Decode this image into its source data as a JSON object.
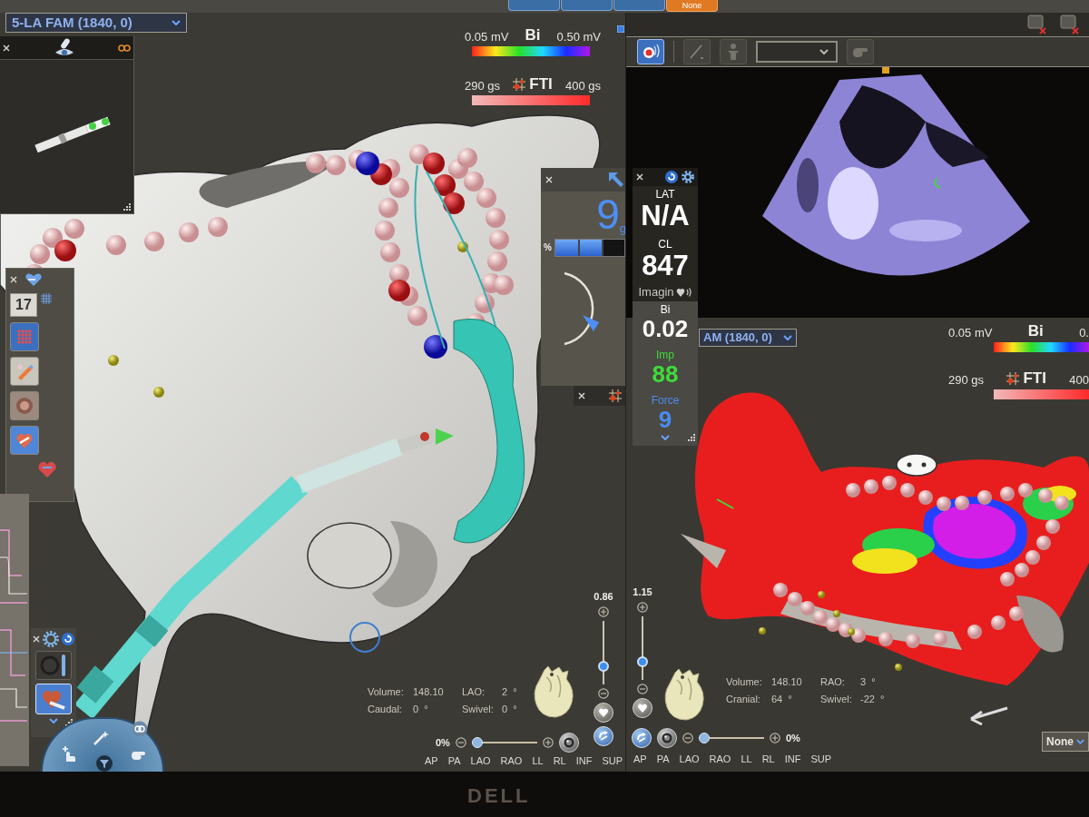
{
  "top_bar": {
    "tabs": [
      {
        "selected": false
      },
      {
        "selected": false
      },
      {
        "selected": false
      },
      {
        "label": "None",
        "selected": true
      }
    ]
  },
  "left_view": {
    "map_selector": "5-LA FAM (1840, 0)",
    "legends": [
      {
        "kind": "rainbow",
        "min": "0.05 mV",
        "name": "Bi",
        "max": "0.50 mV"
      },
      {
        "kind": "force",
        "min": "290 gs",
        "name": "FTI",
        "max": "400 gs"
      }
    ],
    "tool_panel": {
      "count": "17"
    },
    "force_panel": {
      "value": "9",
      "unit": "g",
      "percent_label": "%",
      "level": 0.67
    },
    "stats": [
      {
        "label": "Volume:",
        "value": "148.10"
      },
      {
        "label": "LAO:",
        "value": "2  °"
      },
      {
        "label": "Caudal:",
        "value": "0  °"
      },
      {
        "label": "Swivel:",
        "value": "0  °"
      }
    ],
    "zoom": {
      "value": "0.86",
      "level": 0.25
    },
    "opacity": {
      "value": "0%",
      "level": 0
    },
    "views": [
      "AP",
      "PA",
      "LAO",
      "RAO",
      "LL",
      "RL",
      "INF",
      "SUP"
    ]
  },
  "metrics_panel": {
    "upper": [
      {
        "label": "LAT",
        "value": "N/A",
        "color": "#ffffff"
      },
      {
        "label": "CL",
        "value": "847",
        "color": "#ffffff"
      }
    ],
    "lower": [
      {
        "label": "Bi",
        "value": "0.02",
        "color": "#ffffff"
      },
      {
        "label": "Imp",
        "value": "88",
        "color": "#3ddc3a"
      },
      {
        "label": "Force",
        "value": "9",
        "color": "#4a8cf0"
      }
    ]
  },
  "ultrasound_panel": {
    "toolbar": [
      {
        "kind": "record",
        "selected": true
      },
      {
        "kind": "pen",
        "selected": false
      },
      {
        "kind": "figure",
        "selected": false
      },
      {
        "kind": "dropdown"
      },
      {
        "kind": "hand",
        "selected": false
      }
    ],
    "label": "Imagin"
  },
  "right_view": {
    "map_selector": "AM (1840, 0)",
    "legends": [
      {
        "kind": "rainbow",
        "min": "0.05 mV",
        "name": "Bi",
        "max": "0."
      },
      {
        "kind": "force",
        "min": "290 gs",
        "name": "FTI",
        "max": "400"
      }
    ],
    "stats": [
      {
        "label": "Volume:",
        "value": "148.10"
      },
      {
        "label": "RAO:",
        "value": "3  °"
      },
      {
        "label": "Cranial:",
        "value": "64  °"
      },
      {
        "label": "Swivel:",
        "value": "-22  °"
      }
    ],
    "zoom": {
      "value": "1.15",
      "level": 0.25
    },
    "opacity": {
      "value": "0%",
      "level": 0
    },
    "views": [
      "AP",
      "PA",
      "LAO",
      "RAO",
      "LL",
      "RL",
      "INF",
      "SUP"
    ],
    "mode_selector": "None"
  },
  "monitor": {
    "logo": "DELL"
  }
}
